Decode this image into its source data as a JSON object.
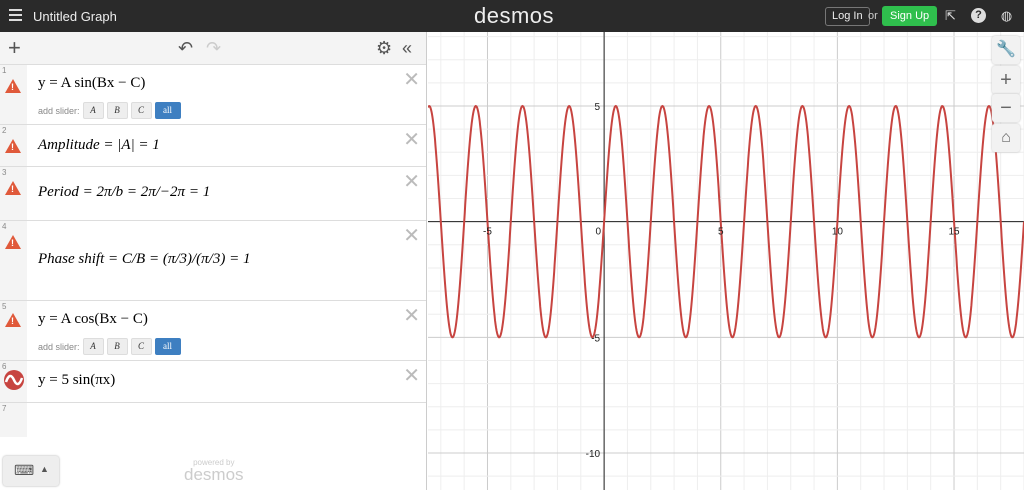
{
  "header": {
    "title": "Untitled Graph",
    "logo": "desmos",
    "login": "Log In",
    "or": "or",
    "signup": "Sign Up",
    "icons": [
      "share-icon",
      "help-icon",
      "globe-icon"
    ]
  },
  "panel": {
    "add": "+",
    "expressions": [
      {
        "n": "1",
        "icon": "warning",
        "latex": "y = A sin(Bx − C)",
        "slider": true
      },
      {
        "n": "2",
        "icon": "warning",
        "latex": "Amplitude = |A| = 1"
      },
      {
        "n": "3",
        "icon": "warning",
        "latex": "Period = 2π/b = 2π/−2π = 1"
      },
      {
        "n": "4",
        "icon": "warning",
        "latex": "Phase shift = C/B = (π/3)/(π/3) = 1"
      },
      {
        "n": "5",
        "icon": "warning",
        "latex": "y = A cos(Bx − C)",
        "slider": true
      },
      {
        "n": "6",
        "icon": "graph",
        "latex": "y = 5 sin(πx)",
        "color": "#c74440"
      },
      {
        "n": "7"
      }
    ],
    "slider_label": "add slider:",
    "slider_buttons": [
      "A",
      "B",
      "C",
      "all"
    ],
    "powered_by": "powered by",
    "powered_logo": "desmos"
  },
  "graph": {
    "x_ticks": [
      "-5",
      "0",
      "5",
      "10",
      "15"
    ],
    "y_ticks": [
      "5",
      "-5",
      "-10"
    ],
    "curve_color": "#c74440",
    "function": "5 sin(pi x)",
    "xrange": [
      -7.55,
      18
    ],
    "yrange": [
      -11.6,
      8.2
    ]
  }
}
